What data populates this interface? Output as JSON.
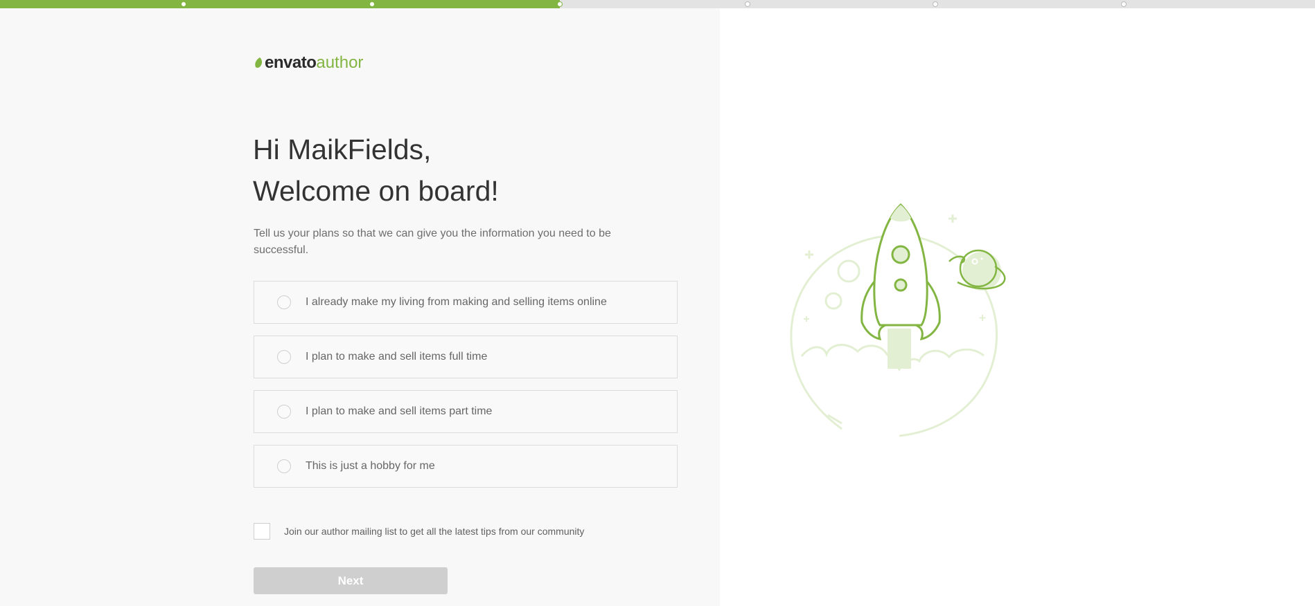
{
  "progress": {
    "total_steps": 7,
    "current_step": 3
  },
  "logo": {
    "brand": "envato",
    "product": "author"
  },
  "greeting": {
    "line1": "Hi MaikFields,",
    "line2": "Welcome on board!"
  },
  "intro": "Tell us your plans so that we can give you the information you need to be successful.",
  "options": [
    {
      "label": "I already make my living from making and selling items online",
      "selected": false
    },
    {
      "label": "I plan to make and sell items full time",
      "selected": false
    },
    {
      "label": "I plan to make and sell items part time",
      "selected": false
    },
    {
      "label": "This is just a hobby for me",
      "selected": false
    }
  ],
  "mailing": {
    "label": "Join our author mailing list to get all the latest tips from our community",
    "checked": false
  },
  "next_button": {
    "label": "Next",
    "disabled": true
  },
  "colors": {
    "accent": "#82b541",
    "illustration_light": "#e3efd3",
    "button_disabled": "#cfcfcf"
  },
  "illustration": {
    "icon": "rocket-illustration"
  }
}
